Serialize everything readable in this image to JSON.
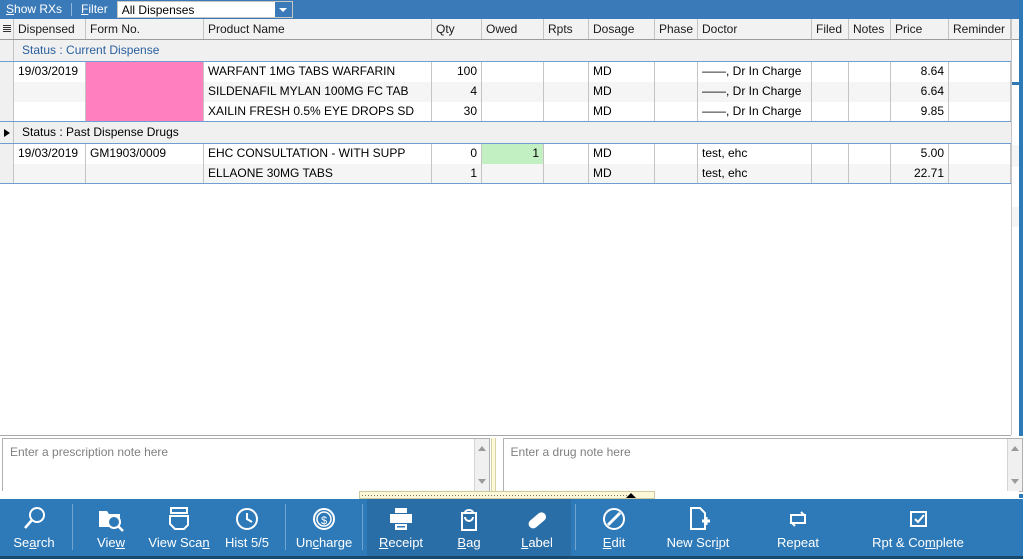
{
  "topbar": {
    "show_rx_label": "Show RXs",
    "show_rx_accel": "S",
    "filter_label": "Filter",
    "filter_accel": "F",
    "combo_value": "All Dispenses",
    "combo_arrow_icon": "chevron-down-icon"
  },
  "grid": {
    "columns": [
      "Dispensed",
      "Form No.",
      "Product Name",
      "Qty",
      "Owed",
      "Rpts",
      "Dosage",
      "Phase",
      "Doctor",
      "Filed",
      "Notes",
      "Price",
      "Reminder"
    ],
    "groups": [
      {
        "label": "Status : Current Dispense",
        "rows": [
          {
            "dispensed": "19/03/2019",
            "form_no": "",
            "product_name": "WARFANT 1MG TABS WARFARIN",
            "qty": "100",
            "owed": "",
            "rpts": "",
            "dosage": "MD",
            "phase": "",
            "doctor": "——, Dr In Charge",
            "filed": "",
            "notes": "",
            "price": "8.64",
            "reminder": ""
          },
          {
            "dispensed": "",
            "form_no": "",
            "product_name": "SILDENAFIL MYLAN 100MG FC TAB",
            "qty": "4",
            "owed": "",
            "rpts": "",
            "dosage": "MD",
            "phase": "",
            "doctor": "——, Dr In Charge",
            "filed": "",
            "notes": "",
            "price": "6.64",
            "reminder": ""
          },
          {
            "dispensed": "",
            "form_no": "",
            "product_name": "XAILIN FRESH 0.5% EYE DROPS SD",
            "qty": "30",
            "owed": "",
            "rpts": "",
            "dosage": "MD",
            "phase": "",
            "doctor": "——, Dr In Charge",
            "filed": "",
            "notes": "",
            "price": "9.85",
            "reminder": ""
          }
        ]
      },
      {
        "label": "Status : Past Dispense Drugs",
        "rows": [
          {
            "dispensed": "19/03/2019",
            "form_no": "GM1903/0009",
            "product_name": "EHC CONSULTATION - WITH SUPP",
            "qty": "0",
            "owed": "1",
            "rpts": "",
            "dosage": "MD",
            "phase": "",
            "doctor": "test, ehc",
            "filed": "",
            "notes": "",
            "price": "5.00",
            "reminder": ""
          },
          {
            "dispensed": "",
            "form_no": "",
            "product_name": "ELLAONE 30MG TABS",
            "qty": "1",
            "owed": "",
            "rpts": "",
            "dosage": "MD",
            "phase": "",
            "doctor": "test, ehc",
            "filed": "",
            "notes": "",
            "price": "22.71",
            "reminder": ""
          }
        ]
      }
    ]
  },
  "notes": {
    "prescription_placeholder": "Enter a prescription note here",
    "prescription_value": "",
    "drug_placeholder": "Enter a drug note here",
    "drug_value": ""
  },
  "toolbar": {
    "buttons": [
      {
        "label": "Search",
        "accel": "a",
        "icon": "magnifier-icon"
      },
      {
        "label": "View",
        "accel": "w",
        "icon": "folder-search-icon"
      },
      {
        "label": "View Scan",
        "accel": "n",
        "icon": "scanner-icon"
      },
      {
        "label": "Hist 5/5",
        "accel": "",
        "icon": "clock-history-icon"
      },
      {
        "label": "Uncharge",
        "accel": "c",
        "icon": "dollar-coin-icon"
      },
      {
        "label": "Receipt",
        "accel": "R",
        "icon": "printer-icon"
      },
      {
        "label": "Bag",
        "accel": "B",
        "icon": "bag-icon"
      },
      {
        "label": "Label",
        "accel": "L",
        "icon": "pill-label-icon"
      },
      {
        "label": "Edit",
        "accel": "E",
        "icon": "pencil-circle-icon"
      },
      {
        "label": "New Script",
        "accel": "i",
        "icon": "new-document-icon"
      },
      {
        "label": "Repeat",
        "accel": "",
        "icon": "repeat-cycle-icon"
      },
      {
        "label": "Rpt & Complete",
        "accel": "m",
        "icon": "repeat-check-icon"
      }
    ]
  },
  "colors": {
    "accent_blue": "#2e7ab8",
    "header_blue": "#3a7ab8",
    "pink_highlight": "#ff7fbf",
    "green_highlight": "#c3f0c3",
    "group_blue_text": "#2a5f9e"
  }
}
